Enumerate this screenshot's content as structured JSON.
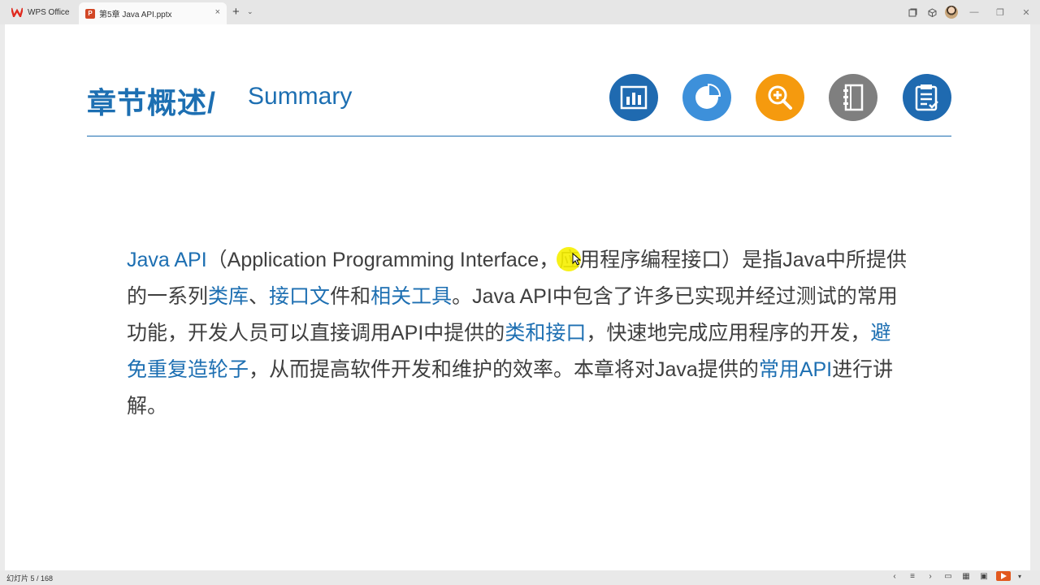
{
  "titlebar": {
    "home_tab": "WPS Office",
    "doc_tab": "第5章 Java API.pptx",
    "doc_badge": "P",
    "close": "×",
    "new_tab": "+",
    "new_tab_menu": "⌄",
    "minimize": "—",
    "restore": "❐",
    "close_window": "✕"
  },
  "slide": {
    "title_cn": "章节概述/",
    "title_en": "Summary",
    "paragraph": [
      {
        "t": "Java API",
        "h": true
      },
      {
        "t": "（Application Programming Interface，应用程序编程接口）是指Java中所提供的一系列",
        "h": false
      },
      {
        "t": "类库",
        "h": true
      },
      {
        "t": "、",
        "h": false
      },
      {
        "t": "接口文",
        "h": true
      },
      {
        "t": "件和",
        "h": false
      },
      {
        "t": "相关工具",
        "h": true
      },
      {
        "t": "。Java API中包含了许多已实现并经过测试的常用功能，开发人员可以直接调用API中提供的",
        "h": false
      },
      {
        "t": "类和接口",
        "h": true
      },
      {
        "t": "，快速地完成应用程序的开发，",
        "h": false
      },
      {
        "t": "避免重复造轮子",
        "h": true
      },
      {
        "t": "，从而提高软件开发和维护的效率。本章将对Java提供的",
        "h": false
      },
      {
        "t": "常用API",
        "h": true
      },
      {
        "t": "进行讲解。",
        "h": false
      }
    ],
    "icons": [
      "bar-chart-icon",
      "pie-chart-icon",
      "zoom-in-icon",
      "notebook-icon",
      "clipboard-check-icon"
    ],
    "colors": {
      "accent": "#1d6fb2",
      "orange": "#f59a0e",
      "gray": "#7f7f7f",
      "light_blue": "#3d90da"
    }
  },
  "statusbar": {
    "slide_count": "幻灯片 5 / 168"
  }
}
